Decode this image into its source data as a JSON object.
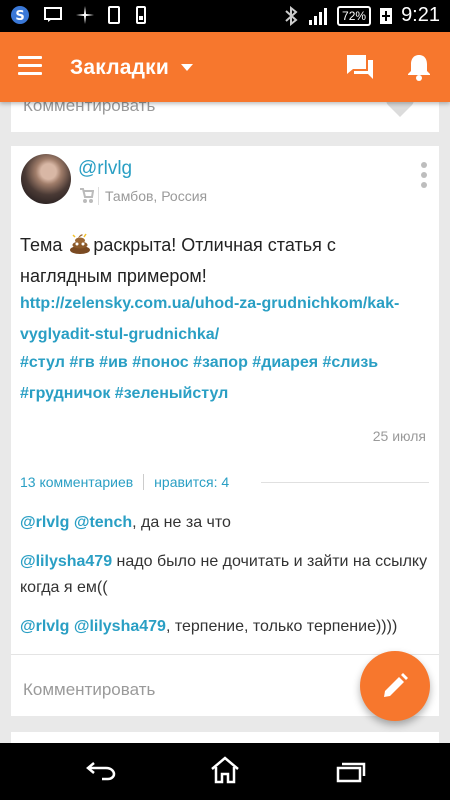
{
  "status_bar": {
    "battery": "72%",
    "time": "9:21"
  },
  "app_bar": {
    "title": "Закладки"
  },
  "previous_card": {
    "comment_placeholder": "Комментировать"
  },
  "post": {
    "username": "@rlvlg",
    "location": "Тамбов, Россия",
    "text_before_emoji": "Тема",
    "text_after_emoji": "раскрыта! Отличная статья с наглядным примером!",
    "link": "http://zelensky.com.ua/uhod-za-grudnichkom/kak-vyglyadit-stul-grudnichka/",
    "tags": "#стул #гв #ив #понос #запор #диарея #слизь #грудничок #зеленыйстул",
    "date": "25 июля",
    "comments_count": "13 комментариев",
    "likes": "нравится: 4",
    "comments": [
      {
        "mentions": "@rlvlg @tench",
        "text": ", да не за что"
      },
      {
        "mentions": "@lilysha479",
        "text": " надо было не дочитать и зайти на ссылку когда я ем(("
      },
      {
        "mentions": "@rlvlg @lilysha479",
        "text": ", терпение, только терпение))))"
      }
    ],
    "comment_placeholder": "Комментировать"
  },
  "colors": {
    "accent": "#f7772d",
    "link": "#2a9fc4"
  },
  "icons": {
    "menu": "menu-icon",
    "title_dropdown": "chevron-down-icon",
    "chat": "chat-icon",
    "notifications": "bell-icon",
    "more": "more-vertical-icon",
    "stroller": "stroller-icon",
    "emoji": "poop-emoji-icon",
    "fab": "pencil-icon",
    "nav_back": "back-icon",
    "nav_home": "home-icon",
    "nav_recent": "recent-apps-icon"
  }
}
